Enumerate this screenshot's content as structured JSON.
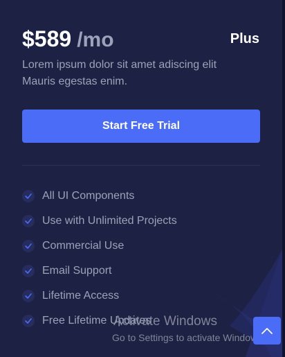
{
  "pricing_card": {
    "price": "$589",
    "period": "/mo",
    "plan_name": "Plus",
    "description": "Lorem ipsum dolor sit amet adiscing elit Mauris egestas enim.",
    "cta_label": "Start Free Trial",
    "features": [
      {
        "label": "All UI Components",
        "icon": "check-icon"
      },
      {
        "label": "Use with Unlimited Projects",
        "icon": "check-icon"
      },
      {
        "label": "Commercial Use",
        "icon": "check-icon"
      },
      {
        "label": "Email Support",
        "icon": "check-icon"
      },
      {
        "label": "Lifetime Access",
        "icon": "check-icon"
      },
      {
        "label": "Free Lifetime Updates",
        "icon": "check-icon"
      }
    ]
  },
  "activation_watermark": {
    "title": "Activate Windows",
    "subtitle": "Go to Settings to activate Windows."
  },
  "scroll_top_button": {
    "icon": "chevron-up-icon"
  },
  "colors": {
    "card_background": "#1d2144",
    "accent": "#4a6cf7",
    "text_primary": "#ffffff",
    "text_secondary": "#9ca3b8",
    "check_badge": "#262c5d"
  }
}
